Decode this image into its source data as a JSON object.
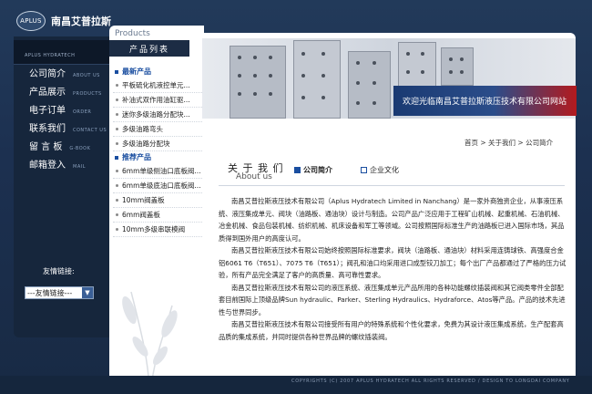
{
  "logo": {
    "badge": "APLUS",
    "name": "南昌艾普拉斯"
  },
  "nav": {
    "header": "APLUS HYDRATECH",
    "items": [
      {
        "cn": "公司简介",
        "en": "ABOUT US"
      },
      {
        "cn": "产品展示",
        "en": "PRODUCTS"
      },
      {
        "cn": "电子订单",
        "en": "ORDER"
      },
      {
        "cn": "联系我们",
        "en": "CONTACT US"
      },
      {
        "cn": "留 言 板",
        "en": "G-BOOK"
      },
      {
        "cn": "邮箱登入",
        "en": "MAIL"
      }
    ],
    "links_label": "友情链接:",
    "links_select": "---友情链接---"
  },
  "products": {
    "head_en": "Products",
    "head_cn": "产品列表",
    "cat_new": "最新产品",
    "new_items": [
      "平板硫化机液控单元...",
      "补油式双作用油缸驱...",
      "迷你多级油路分配块...",
      "多级油路弯头",
      "多级油路分配块"
    ],
    "cat_rec": "推荐产品",
    "rec_items": [
      "6mm单级侧油口底板阀...",
      "6mm单级底油口底板阀...",
      "10mm阀盖板",
      "6mm阀盖板",
      "10mm多级串联模阀"
    ]
  },
  "banner": {
    "welcome": "欢迎光临南昌艾普拉斯液压技术有限公司网站"
  },
  "breadcrumb": "首页 > 关于我们 > 公司简介",
  "about": {
    "title": "关 于 我 们",
    "subtitle": "About us",
    "tab1": "公司简介",
    "tab2": "企业文化"
  },
  "content": {
    "p1": "南昌艾普拉斯液压技术有限公司（Aplus Hydratech Limited in Nanchang）是一家外商独资企业，从事液压系统、液压集成单元、阀块（油路板、通油块）设计与制造。公司产品广泛应用于工程矿山机械、起重机械、石油机械、冶金机械、食品包装机械、纺织机械、机床设备和军工等领域。公司按照国际标准生产的油路板已进入国际市场，其品质得到国外用户的高度认可。",
    "p2": "南昌艾普拉斯液压技术有限公司始终按照国际标准要求，阀块（油路板、通油块）材料采用连铸球铁、高强度合金铝6061 T6（T651）、7075 T6（T651）；阀孔和油口均采用进口成型铰刀加工；每个出厂产品都通过了严格的压力试验，所有产品完全满足了客户的高质量、高可靠性要求。",
    "p3": "南昌艾普拉斯液压技术有限公司的液压系统、液压集成单元产品所用的各种功能螺纹插装阀和其它阀类零件全部配套目前国际上顶级品牌Sun hydraulic、Parker、Sterling Hydraulics、Hydraforce、Atos等产品。产品的技术先进性与世界同步。",
    "p4": "南昌艾普拉斯液压技术有限公司接受所有用户的特殊系统和个性化要求，免费为其设计液压集成系统，生产配套高品质的集成系统，并同时提供各种世界品牌的螺纹插装阀。"
  },
  "footer": {
    "copyright": "COPYRIGHTS (C) 2007 APLUS HYDRATECH ALL RIGHTS RESERVED / DESIGN TO LONGDAI COMPANY"
  },
  "colors": {
    "navy": "#16263c",
    "accent": "#1a4ea0",
    "banner_red": "#b31a1e"
  }
}
